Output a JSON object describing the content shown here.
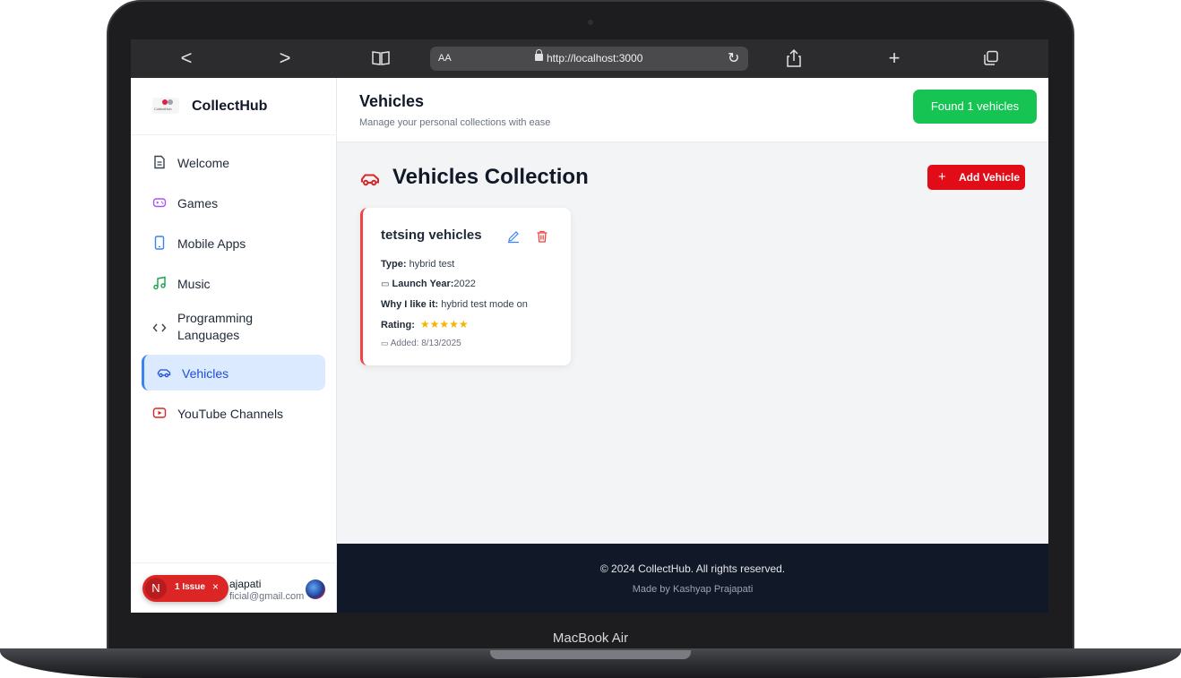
{
  "device": {
    "model_label": "MacBook Air"
  },
  "browser": {
    "back": "<",
    "forward": ">",
    "aa": "AA",
    "url": "http://localhost:3000",
    "add_tab": "+"
  },
  "sidebar": {
    "brand_logo_text": "CollectHub",
    "brand_name": "CollectHub",
    "items": [
      {
        "label": "Welcome",
        "icon": "document-icon",
        "color": "#374151"
      },
      {
        "label": "Games",
        "icon": "gamepad-icon",
        "color": "#a855f7"
      },
      {
        "label": "Mobile Apps",
        "icon": "smartphone-icon",
        "color": "#3b82f6"
      },
      {
        "label": "Music",
        "icon": "music-icon",
        "color": "#16a34a"
      },
      {
        "label": "Programming Languages",
        "icon": "code-icon",
        "color": "#374151"
      },
      {
        "label": "Vehicles",
        "icon": "car-icon",
        "color": "#1d4ed8",
        "active": true
      },
      {
        "label": "YouTube Channels",
        "icon": "youtube-icon",
        "color": "#dc2626"
      }
    ],
    "user": {
      "name_visible": "ajapati",
      "email_visible": "ficial@gmail.com"
    },
    "issue_badge": {
      "letter": "N",
      "text": "1 Issue",
      "close": "×"
    }
  },
  "header": {
    "title": "Vehicles",
    "subtitle": "Manage your personal collections with ease",
    "found_label": "Found 1 vehicles"
  },
  "collection": {
    "title": "Vehicles Collection",
    "add_plus": "+",
    "add_label": "Add Vehicle"
  },
  "card": {
    "title": "tetsing vehicles",
    "type_label": "Type:",
    "type_value": "hybrid test",
    "year_label": "Launch Year:",
    "year_value": "2022",
    "why_label": "Why I like it:",
    "why_value": "hybrid test mode on",
    "rating_label": "Rating:",
    "rating_value": 5,
    "rating_max": 5,
    "stars": "★★★★★",
    "added": "Added: 8/13/2025"
  },
  "footer": {
    "copyright": "© 2024 CollectHub. All rights reserved.",
    "made_by": "Made by Kashyap Prajapati"
  },
  "colors": {
    "accent_green": "#16c453",
    "accent_red": "#e10c17",
    "active_blue": "#3b82f6",
    "footer_bg": "#111827"
  }
}
